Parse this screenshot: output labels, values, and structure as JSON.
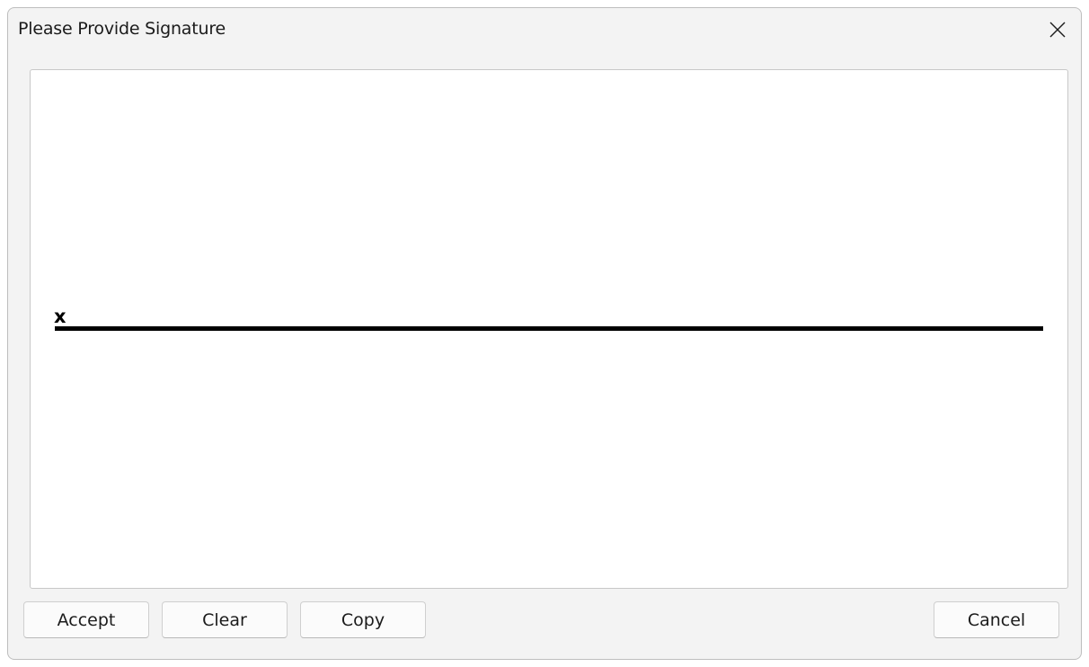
{
  "window": {
    "title": "Please Provide Signature"
  },
  "signature_pad": {
    "marker": "x"
  },
  "buttons": {
    "accept": "Accept",
    "clear": "Clear",
    "copy": "Copy",
    "cancel": "Cancel"
  },
  "icons": {
    "close": "close-icon"
  },
  "colors": {
    "window_bg": "#f3f3f3",
    "canvas_bg": "#ffffff",
    "signature_line": "#000000",
    "text": "#1b1b1b"
  }
}
